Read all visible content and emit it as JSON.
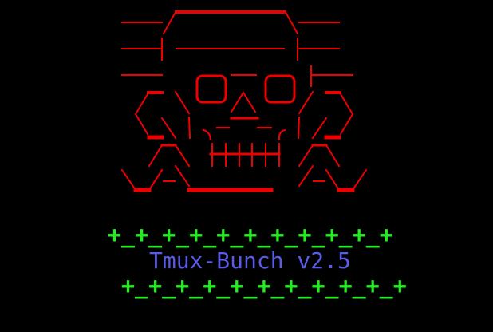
{
  "terminal": {
    "logo": {
      "description_icon": "skull-crossbones-ascii-art",
      "color": "#ee0000"
    },
    "border_top": "+_+_+_+_+_+_+_+_+_+_+",
    "title": "Tmux-Bunch v2.5",
    "border_bottom": "+_+_+_+_+_+_+_+_+_+_+",
    "colors": {
      "background": "#000000",
      "border": "#22ee22",
      "title": "#5b5bea"
    }
  }
}
